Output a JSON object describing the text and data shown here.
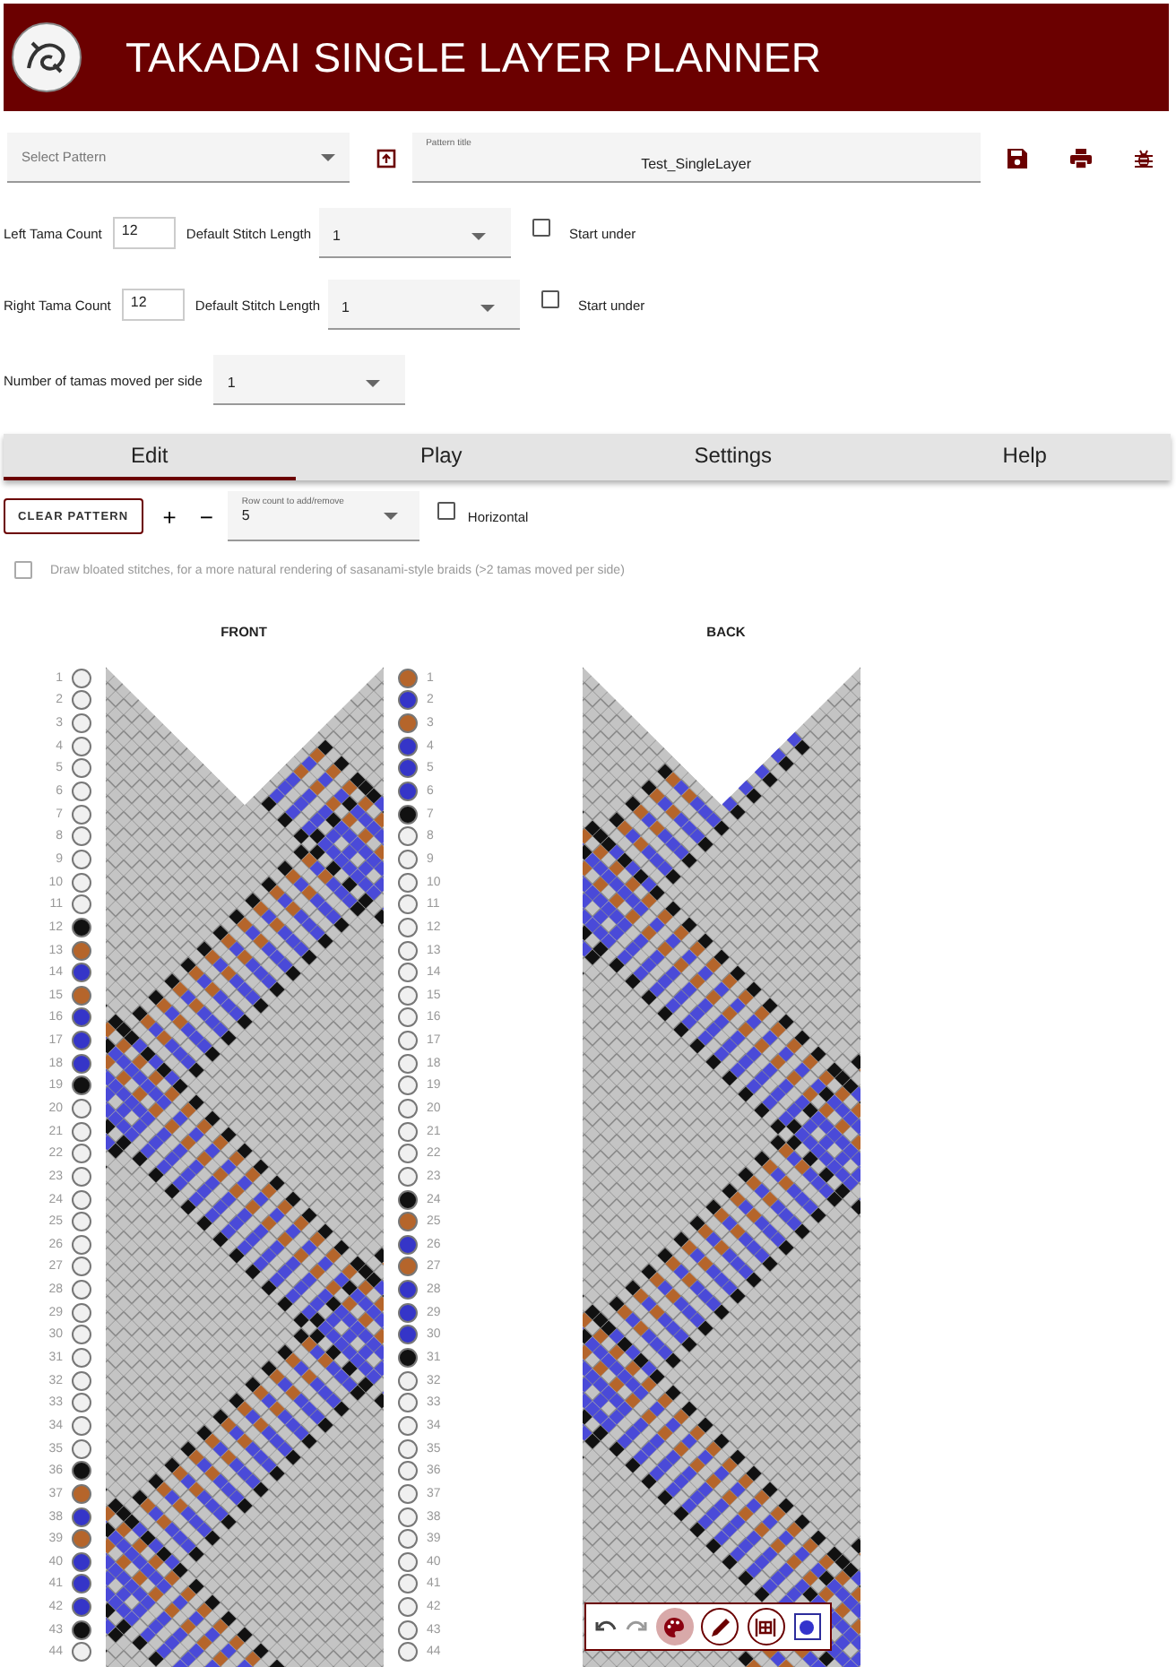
{
  "app": {
    "title": "TAKADAI SINGLE LAYER PLANNER"
  },
  "pattern_select": {
    "placeholder": "Select Pattern"
  },
  "pattern_title": {
    "label": "Pattern title",
    "value": "Test_SingleLayer"
  },
  "sides": [
    {
      "count_label": "Left Tama Count",
      "count": "12",
      "stitch_label": "Default Stitch Length",
      "stitch": "1",
      "start_under_label": "Start under",
      "start_under": false
    },
    {
      "count_label": "Right Tama Count",
      "count": "12",
      "stitch_label": "Default Stitch Length",
      "stitch": "1",
      "start_under_label": "Start under",
      "start_under": false
    }
  ],
  "tamas_moved": {
    "label": "Number of tamas moved per side",
    "value": "1"
  },
  "tabs": [
    {
      "label": "Edit",
      "selected": true
    },
    {
      "label": "Play",
      "selected": false
    },
    {
      "label": "Settings",
      "selected": false
    },
    {
      "label": "Help",
      "selected": false
    }
  ],
  "edit": {
    "clear_button": "CLEAR PATTERN",
    "add": "+",
    "remove": "−",
    "row_count": {
      "label": "Row count to add/remove",
      "value": "5"
    },
    "horizontal": {
      "label": "Horizontal",
      "checked": false
    },
    "bloated": {
      "label": "Draw bloated stitches, for a more natural rendering of sasanami-style braids (>2 tamas moved per side)",
      "checked": false
    }
  },
  "views": {
    "front_label": "FRONT",
    "back_label": "BACK"
  },
  "left_tamas": [
    {
      "number": "1",
      "color": "#f0f0f0"
    },
    {
      "number": "2",
      "color": "#f0f0f0"
    },
    {
      "number": "3",
      "color": "#f0f0f0"
    },
    {
      "number": "4",
      "color": "#f0f0f0"
    },
    {
      "number": "5",
      "color": "#f0f0f0"
    },
    {
      "number": "6",
      "color": "#f0f0f0"
    },
    {
      "number": "7",
      "color": "#f0f0f0"
    },
    {
      "number": "8",
      "color": "#f0f0f0"
    },
    {
      "number": "9",
      "color": "#f0f0f0"
    },
    {
      "number": "10",
      "color": "#f0f0f0"
    },
    {
      "number": "11",
      "color": "#f0f0f0"
    },
    {
      "number": "12",
      "color": "#111111"
    },
    {
      "number": "13",
      "color": "#b5652b"
    },
    {
      "number": "14",
      "color": "#3535c8"
    },
    {
      "number": "15",
      "color": "#b5652b"
    },
    {
      "number": "16",
      "color": "#3535c8"
    },
    {
      "number": "17",
      "color": "#3535c8"
    },
    {
      "number": "18",
      "color": "#3535c8"
    },
    {
      "number": "19",
      "color": "#111111"
    },
    {
      "number": "20",
      "color": "#f0f0f0"
    },
    {
      "number": "21",
      "color": "#f0f0f0"
    },
    {
      "number": "22",
      "color": "#f0f0f0"
    },
    {
      "number": "23",
      "color": "#f0f0f0"
    },
    {
      "number": "24",
      "color": "#f0f0f0"
    },
    {
      "number": "25",
      "color": "#f0f0f0"
    },
    {
      "number": "26",
      "color": "#f0f0f0"
    },
    {
      "number": "27",
      "color": "#f0f0f0"
    },
    {
      "number": "28",
      "color": "#f0f0f0"
    },
    {
      "number": "29",
      "color": "#f0f0f0"
    },
    {
      "number": "30",
      "color": "#f0f0f0"
    },
    {
      "number": "31",
      "color": "#f0f0f0"
    },
    {
      "number": "32",
      "color": "#f0f0f0"
    },
    {
      "number": "33",
      "color": "#f0f0f0"
    },
    {
      "number": "34",
      "color": "#f0f0f0"
    },
    {
      "number": "35",
      "color": "#f0f0f0"
    },
    {
      "number": "36",
      "color": "#111111"
    },
    {
      "number": "37",
      "color": "#b5652b"
    },
    {
      "number": "38",
      "color": "#3535c8"
    },
    {
      "number": "39",
      "color": "#b5652b"
    },
    {
      "number": "40",
      "color": "#3535c8"
    },
    {
      "number": "41",
      "color": "#3535c8"
    },
    {
      "number": "42",
      "color": "#3535c8"
    },
    {
      "number": "43",
      "color": "#111111"
    },
    {
      "number": "44",
      "color": "#f0f0f0"
    }
  ],
  "right_tamas": [
    {
      "number": "1",
      "color": "#b5652b"
    },
    {
      "number": "2",
      "color": "#3535c8"
    },
    {
      "number": "3",
      "color": "#b5652b"
    },
    {
      "number": "4",
      "color": "#3535c8"
    },
    {
      "number": "5",
      "color": "#3535c8"
    },
    {
      "number": "6",
      "color": "#3535c8"
    },
    {
      "number": "7",
      "color": "#111111"
    },
    {
      "number": "8",
      "color": "#f0f0f0"
    },
    {
      "number": "9",
      "color": "#f0f0f0"
    },
    {
      "number": "10",
      "color": "#f0f0f0"
    },
    {
      "number": "11",
      "color": "#f0f0f0"
    },
    {
      "number": "12",
      "color": "#f0f0f0"
    },
    {
      "number": "13",
      "color": "#f0f0f0"
    },
    {
      "number": "14",
      "color": "#f0f0f0"
    },
    {
      "number": "15",
      "color": "#f0f0f0"
    },
    {
      "number": "16",
      "color": "#f0f0f0"
    },
    {
      "number": "17",
      "color": "#f0f0f0"
    },
    {
      "number": "18",
      "color": "#f0f0f0"
    },
    {
      "number": "19",
      "color": "#f0f0f0"
    },
    {
      "number": "20",
      "color": "#f0f0f0"
    },
    {
      "number": "21",
      "color": "#f0f0f0"
    },
    {
      "number": "22",
      "color": "#f0f0f0"
    },
    {
      "number": "23",
      "color": "#f0f0f0"
    },
    {
      "number": "24",
      "color": "#111111"
    },
    {
      "number": "25",
      "color": "#b5652b"
    },
    {
      "number": "26",
      "color": "#3535c8"
    },
    {
      "number": "27",
      "color": "#b5652b"
    },
    {
      "number": "28",
      "color": "#3535c8"
    },
    {
      "number": "29",
      "color": "#3535c8"
    },
    {
      "number": "30",
      "color": "#3535c8"
    },
    {
      "number": "31",
      "color": "#111111"
    },
    {
      "number": "32",
      "color": "#f0f0f0"
    },
    {
      "number": "33",
      "color": "#f0f0f0"
    },
    {
      "number": "34",
      "color": "#f0f0f0"
    },
    {
      "number": "35",
      "color": "#f0f0f0"
    },
    {
      "number": "36",
      "color": "#f0f0f0"
    },
    {
      "number": "37",
      "color": "#f0f0f0"
    },
    {
      "number": "38",
      "color": "#f0f0f0"
    },
    {
      "number": "39",
      "color": "#f0f0f0"
    },
    {
      "number": "40",
      "color": "#f0f0f0"
    },
    {
      "number": "41",
      "color": "#f0f0f0"
    },
    {
      "number": "42",
      "color": "#f0f0f0"
    },
    {
      "number": "43",
      "color": "#f0f0f0"
    },
    {
      "number": "44",
      "color": "#f0f0f0"
    }
  ],
  "toolbar": {
    "tools": [
      {
        "kind": "undo"
      },
      {
        "kind": "redo"
      },
      {
        "kind": "palette",
        "selected": true
      },
      {
        "kind": "pencil",
        "selected": false
      },
      {
        "kind": "pattern",
        "selected": false
      },
      {
        "kind": "color",
        "color": "#3333cc"
      }
    ]
  }
}
